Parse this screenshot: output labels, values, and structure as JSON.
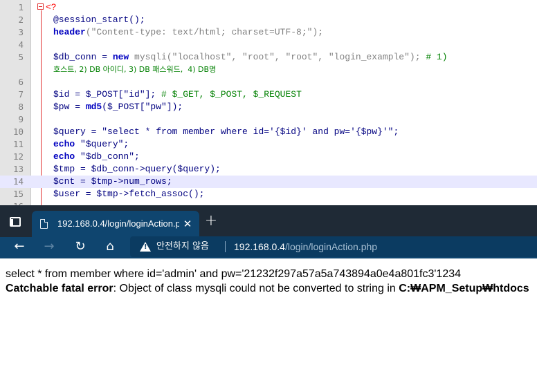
{
  "editor": {
    "line_numbers": [
      "1",
      "2",
      "3",
      "4",
      "5",
      "",
      "6",
      "7",
      "8",
      "9",
      "10",
      "11",
      "12",
      "13",
      "14",
      "15",
      "16"
    ],
    "lines": {
      "l1": "<?",
      "l2": "@session_start();",
      "l3a": "header",
      "l3b": "(\"Content-type: text/html; charset=UTF-8;\");",
      "l5a": "$db_conn = ",
      "l5b": "new",
      "l5c": " mysqli(\"localhost\", \"root\", \"root\", \"login_example\"); ",
      "l5d": "# 1)",
      "l5e": "호스트, 2) DB 아이디, 3) DB 패스워드,  4) DB명",
      "l7a": "$id = $_POST[\"id\"]; ",
      "l7b": "# $_GET, $_POST, $_REQUEST",
      "l8a": "$pw = ",
      "l8b": "md5",
      "l8c": "($_POST[\"pw\"]);",
      "l10": "$query = \"select * from member where id='{$id}' and pw='{$pw}'\";",
      "l11a": "echo",
      "l11b": " \"$query\";",
      "l12a": "echo",
      "l12b": " \"$db_conn\";",
      "l13": "$tmp = $db_conn->query($query);",
      "l14": "$cnt = $tmp->num_rows;",
      "l15": "$user = $tmp->fetch_assoc();"
    }
  },
  "browser": {
    "tab_title": "192.168.0.4/login/loginAction.php",
    "close_glyph": "✕",
    "newtab_glyph": "+",
    "back_glyph": "←",
    "forward_glyph": "→",
    "refresh_glyph": "↻",
    "home_glyph": "⌂",
    "insecure_label": "안전하지 않음",
    "url_host": "192.168.0.4",
    "url_path": "/login/loginAction.php"
  },
  "page": {
    "query_output": "select * from member where id='admin' and pw='21232f297a57a5a743894a0e4a801fc3'1234",
    "error_label": "Catchable fatal error",
    "error_message": ": Object of class mysqli could not be converted to string in ",
    "error_path": "C:₩APM_Setup₩htdocs"
  },
  "icons": {
    "fold": "fold-collapse-icon",
    "tab_actions": "tab-actions-icon",
    "favicon": "page-icon",
    "warning": "warning-icon"
  },
  "colors": {
    "tabbar_bg": "#1f2a36",
    "toolbar_bg": "#0f456f",
    "current_line": "#e8e8ff"
  }
}
